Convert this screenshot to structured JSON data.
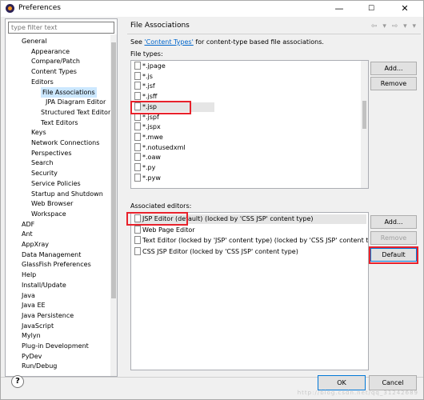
{
  "window": {
    "title": "Preferences",
    "minimize": "—",
    "maximize": "☐",
    "close": "✕"
  },
  "filter": {
    "placeholder": "type filter text"
  },
  "tree": [
    "General",
    "Appearance",
    "Compare/Patch",
    "Content Types",
    "Editors",
    "File Associations",
    "JPA Diagram Editor",
    "Structured Text Editors",
    "Text Editors",
    "Keys",
    "Network Connections",
    "Perspectives",
    "Search",
    "Security",
    "Service Policies",
    "Startup and Shutdown",
    "Web Browser",
    "Workspace",
    "ADF",
    "Ant",
    "AppXray",
    "Data Management",
    "GlassFish Preferences",
    "Help",
    "Install/Update",
    "Java",
    "Java EE",
    "Java Persistence",
    "JavaScript",
    "Mylyn",
    "Plug-in Development",
    "PyDev",
    "Run/Debug"
  ],
  "page": {
    "title": "File Associations",
    "desc_prefix": "See ",
    "desc_link": "'Content Types'",
    "desc_suffix": " for content-type based file associations.",
    "file_types_label": "File types:",
    "file_types": [
      "*.jpage",
      "*.js",
      "*.jsf",
      "*.jsff",
      "*.jsp",
      "*.jspf",
      "*.jspx",
      "*.mwe",
      "*.notusedxml",
      "*.oaw",
      "*.py",
      "*.pyw"
    ],
    "assoc_label": "Associated editors:",
    "editors": [
      "JSP Editor (default) (locked by 'CSS JSP' content type)",
      "Web Page Editor",
      "Text Editor (locked by 'JSP' content type) (locked by 'CSS JSP' content type)",
      "CSS JSP Editor (locked by 'CSS JSP' content type)"
    ],
    "buttons": {
      "add": "Add...",
      "remove": "Remove",
      "add2": "Add...",
      "remove2": "Remove",
      "default": "Default"
    }
  },
  "footer": {
    "help": "?",
    "ok": "OK",
    "cancel": "Cancel"
  },
  "watermark": "http://blog.csdn.net/qq_31242689"
}
